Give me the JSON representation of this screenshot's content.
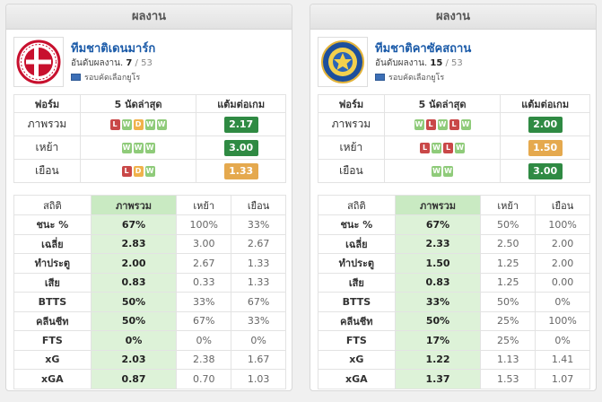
{
  "teams": [
    {
      "header": "ผลงาน",
      "name": "ทีมชาติเดนมาร์ก",
      "rank_label": "อันดับผลงาน.",
      "rank": "7",
      "rank_total": "/ 53",
      "competition": "รอบคัดเลือกยูโร",
      "logo": "dbu-crest",
      "form_headers": [
        "ฟอร์ม",
        "5 นัดล่าสุด",
        "แต้มต่อเกม"
      ],
      "form_rows": [
        {
          "label": "ภาพรวม",
          "results": [
            "L",
            "W",
            "D",
            "W",
            "W"
          ],
          "ppg": "2.17",
          "ppg_color": "#2f8a43"
        },
        {
          "label": "เหย้า",
          "results": [
            "W",
            "W",
            "W"
          ],
          "ppg": "3.00",
          "ppg_color": "#2f8a43"
        },
        {
          "label": "เยือน",
          "results": [
            "L",
            "D",
            "W"
          ],
          "ppg": "1.33",
          "ppg_color": "#e5a94e"
        }
      ],
      "stats_headers": [
        "สถิติ",
        "ภาพรวม",
        "เหย้า",
        "เยือน"
      ],
      "stats_rows": [
        {
          "label": "ชนะ %",
          "ov": "67%",
          "home": "100%",
          "away": "33%"
        },
        {
          "label": "เฉลี่ย",
          "ov": "2.83",
          "home": "3.00",
          "away": "2.67"
        },
        {
          "label": "ทำประตู",
          "ov": "2.00",
          "home": "2.67",
          "away": "1.33"
        },
        {
          "label": "เสีย",
          "ov": "0.83",
          "home": "0.33",
          "away": "1.33"
        },
        {
          "label": "BTTS",
          "ov": "50%",
          "home": "33%",
          "away": "67%"
        },
        {
          "label": "คลีนชีท",
          "ov": "50%",
          "home": "67%",
          "away": "33%"
        },
        {
          "label": "FTS",
          "ov": "0%",
          "home": "0%",
          "away": "0%"
        },
        {
          "label": "xG",
          "ov": "2.03",
          "home": "2.38",
          "away": "1.67"
        },
        {
          "label": "xGA",
          "ov": "0.87",
          "home": "0.70",
          "away": "1.03"
        }
      ]
    },
    {
      "header": "ผลงาน",
      "name": "ทีมชาติคาซัคสถาน",
      "rank_label": "อันดับผลงาน.",
      "rank": "15",
      "rank_total": "/ 53",
      "competition": "รอบคัดเลือกยูโร",
      "logo": "kff-crest",
      "form_headers": [
        "ฟอร์ม",
        "5 นัดล่าสุด",
        "แต้มต่อเกม"
      ],
      "form_rows": [
        {
          "label": "ภาพรวม",
          "results": [
            "W",
            "L",
            "W",
            "L",
            "W"
          ],
          "ppg": "2.00",
          "ppg_color": "#2f8a43"
        },
        {
          "label": "เหย้า",
          "results": [
            "L",
            "W",
            "L",
            "W"
          ],
          "ppg": "1.50",
          "ppg_color": "#e5a94e"
        },
        {
          "label": "เยือน",
          "results": [
            "W",
            "W"
          ],
          "ppg": "3.00",
          "ppg_color": "#2f8a43"
        }
      ],
      "stats_headers": [
        "สถิติ",
        "ภาพรวม",
        "เหย้า",
        "เยือน"
      ],
      "stats_rows": [
        {
          "label": "ชนะ %",
          "ov": "67%",
          "home": "50%",
          "away": "100%"
        },
        {
          "label": "เฉลี่ย",
          "ov": "2.33",
          "home": "2.50",
          "away": "2.00"
        },
        {
          "label": "ทำประตู",
          "ov": "1.50",
          "home": "1.25",
          "away": "2.00"
        },
        {
          "label": "เสีย",
          "ov": "0.83",
          "home": "1.25",
          "away": "0.00"
        },
        {
          "label": "BTTS",
          "ov": "33%",
          "home": "50%",
          "away": "0%"
        },
        {
          "label": "คลีนชีท",
          "ov": "50%",
          "home": "25%",
          "away": "100%"
        },
        {
          "label": "FTS",
          "ov": "17%",
          "home": "25%",
          "away": "0%"
        },
        {
          "label": "xG",
          "ov": "1.22",
          "home": "1.13",
          "away": "1.41"
        },
        {
          "label": "xGA",
          "ov": "1.37",
          "home": "1.53",
          "away": "1.07"
        }
      ]
    }
  ]
}
